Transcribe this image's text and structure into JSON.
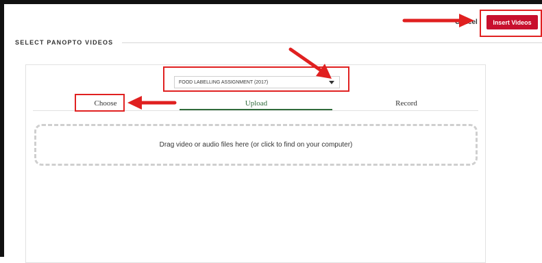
{
  "header": {
    "cancel_label": "Cancel",
    "insert_label": "Insert Videos"
  },
  "section": {
    "title": "SELECT PANOPTO VIDEOS"
  },
  "folder_select": {
    "selected": "FOOD LABELLING ASSIGNMENT (2017)"
  },
  "tabs": [
    {
      "label": "Choose",
      "active": false
    },
    {
      "label": "Upload",
      "active": true
    },
    {
      "label": "Record",
      "active": false
    }
  ],
  "dropzone": {
    "text": "Drag video or audio files here (or click to find on your computer)"
  },
  "colors": {
    "insert_button": "#c8102e",
    "upload_tab_accent": "#2f6b3a",
    "annotation": "#e02020"
  },
  "icons": [
    "dropdown-caret-icon",
    "annotation-arrow-icon"
  ]
}
